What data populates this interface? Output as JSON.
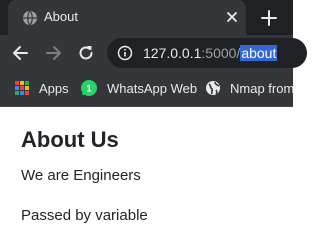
{
  "tab": {
    "title": "About",
    "favicon": "globe-icon",
    "close_icon": "close-icon",
    "new_tab_icon": "plus-icon"
  },
  "toolbar": {
    "back_icon": "back-arrow-icon",
    "forward_icon": "forward-arrow-icon",
    "reload_icon": "reload-icon",
    "info_icon": "info-icon",
    "url": {
      "host": "127.0.0.1",
      "port": ":5000/",
      "path": "about"
    }
  },
  "bookmarks": [
    {
      "label": "Apps",
      "icon": "apps-grid-icon"
    },
    {
      "label": "WhatsApp Web",
      "icon": "whatsapp-icon"
    },
    {
      "label": "Nmap from",
      "icon": "globe-icon"
    }
  ],
  "page": {
    "heading": "About Us",
    "line1": "We are Engineers",
    "line2": "Passed by variable"
  },
  "colors": {
    "browser_frame": "#202124",
    "toolbar": "#35363a",
    "selection": "#3367d6",
    "whatsapp": "#25d366"
  }
}
